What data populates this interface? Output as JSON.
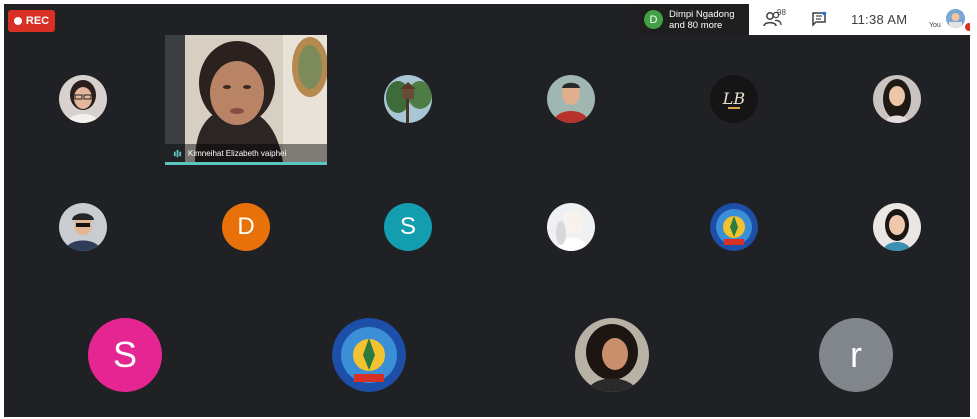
{
  "recording": {
    "label": "REC"
  },
  "topbar": {
    "presenter_initial": "D",
    "presenter_name": "Dimpi Ngadong",
    "presenter_more": "and 80 more",
    "participant_count": "98",
    "time": "11:38 AM",
    "self_label": "You"
  },
  "main_tile": {
    "name": "Kimneihat Elizabeth vaiphei"
  },
  "participants_row1": [
    {
      "type": "photo",
      "icon": "woman-glasses-photo"
    },
    {
      "type": "photo",
      "icon": "treehouse-photo"
    },
    {
      "type": "photo",
      "icon": "man-red-shirt-photo"
    },
    {
      "type": "logo",
      "icon": "lb-logo",
      "text": "LB"
    },
    {
      "type": "photo",
      "icon": "woman-long-hair-photo"
    }
  ],
  "participants_row2": [
    {
      "type": "photo",
      "icon": "man-cap-photo"
    },
    {
      "type": "initial",
      "initial": "D",
      "color": "#e8710a"
    },
    {
      "type": "initial",
      "initial": "S",
      "color": "#129eaf"
    },
    {
      "type": "photo",
      "icon": "bright-figure-photo"
    },
    {
      "type": "logo",
      "icon": "university-emblem-icon"
    },
    {
      "type": "photo",
      "icon": "woman-portrait-photo"
    }
  ],
  "participants_row3": [
    {
      "type": "initial",
      "initial": "S",
      "color": "#e52592"
    },
    {
      "type": "logo",
      "icon": "university-emblem-icon",
      "text": "RAJIV GANDHI UNIVERSITY"
    },
    {
      "type": "photo",
      "icon": "woman-curly-hair-photo"
    },
    {
      "type": "initial",
      "initial": "r",
      "color": "#80868b"
    }
  ],
  "colors": {
    "background": "#202124",
    "rec": "#d93025",
    "speaking_border": "#5bc6c0"
  }
}
